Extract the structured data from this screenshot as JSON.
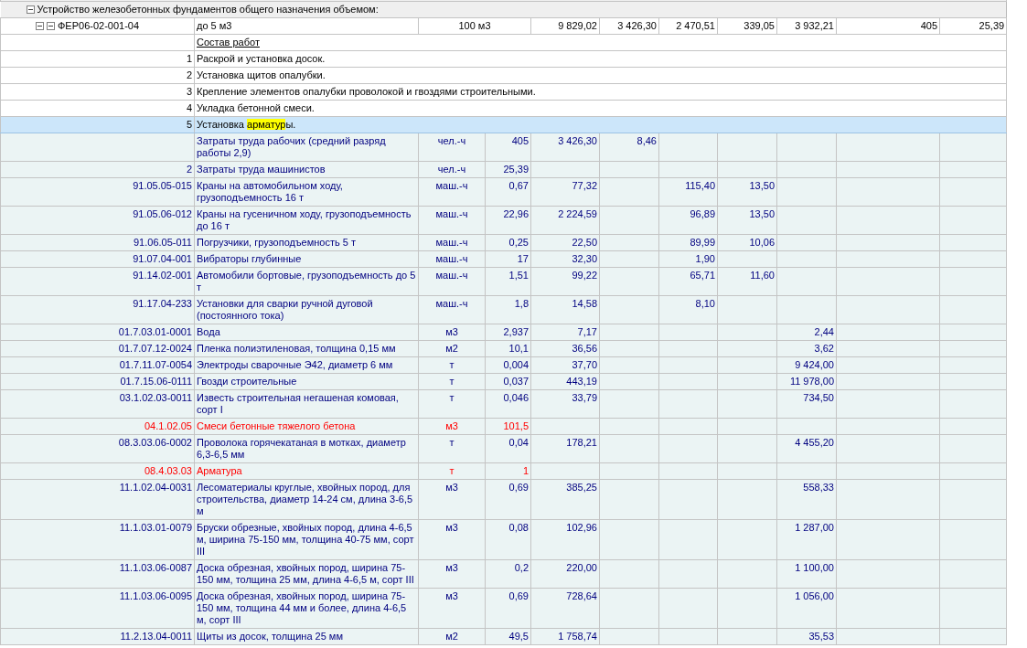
{
  "group": {
    "title": "Устройство железобетонных фундаментов общего назначения объемом:",
    "expanded": true
  },
  "item": {
    "code": "ФЕР06-02-001-04",
    "name": "до 5 м3",
    "unit": "100 м3",
    "expanded": true,
    "values": [
      "9 829,02",
      "3 426,30",
      "2 470,51",
      "339,05",
      "3 932,21",
      "405",
      "25,39"
    ]
  },
  "work_header": "Состав работ",
  "steps": [
    {
      "number": "1",
      "parts": [
        {
          "text": "Раскрой и установка досок.",
          "highlighted": false
        }
      ],
      "selected": false
    },
    {
      "number": "2",
      "parts": [
        {
          "text": "Установка щитов опалубки.",
          "highlighted": false
        }
      ],
      "selected": false
    },
    {
      "number": "3",
      "parts": [
        {
          "text": "Крепление элементов опалубки проволокой и гвоздями строительными.",
          "highlighted": false
        }
      ],
      "selected": false
    },
    {
      "number": "4",
      "parts": [
        {
          "text": "Укладка бетонной смеси.",
          "highlighted": false
        }
      ],
      "selected": false
    },
    {
      "number": "5",
      "parts": [
        {
          "text": "Установка ",
          "highlighted": false
        },
        {
          "text": "арматур",
          "highlighted": true
        },
        {
          "text": "ы.",
          "highlighted": false
        }
      ],
      "selected": true
    }
  ],
  "resources": [
    {
      "name": "Затраты труда рабочих (средний разряд работы 2,9)",
      "unit": "чел.-ч",
      "qty": "405",
      "cols": {
        "col_5": "3 426,30",
        "col_6": "8,46"
      },
      "color": "#000080"
    },
    {
      "code": "2",
      "name": "Затраты труда машинистов",
      "unit": "чел.-ч",
      "qty": "25,39",
      "color": "#000080"
    },
    {
      "code": "91.05.05-015",
      "name": "Краны на автомобильном ходу, грузоподъемность 16 т",
      "unit": "маш.-ч",
      "qty": "0,67",
      "cols": {
        "col_5": "77,32",
        "col_7": "115,40",
        "col_8": "13,50"
      },
      "color": "#000080"
    },
    {
      "code": "91.05.06-012",
      "name": "Краны на гусеничном ходу, грузоподъемность до 16 т",
      "unit": "маш.-ч",
      "qty": "22,96",
      "cols": {
        "col_5": "2 224,59",
        "col_7": "96,89",
        "col_8": "13,50"
      },
      "color": "#000080"
    },
    {
      "code": "91.06.05-011",
      "name": "Погрузчики, грузоподъемность 5 т",
      "unit": "маш.-ч",
      "qty": "0,25",
      "cols": {
        "col_5": "22,50",
        "col_7": "89,99",
        "col_8": "10,06"
      },
      "color": "#000080"
    },
    {
      "code": "91.07.04-001",
      "name": "Вибраторы глубинные",
      "unit": "маш.-ч",
      "qty": "17",
      "cols": {
        "col_5": "32,30",
        "col_7": "1,90"
      },
      "color": "#000080"
    },
    {
      "code": "91.14.02-001",
      "name": "Автомобили бортовые, грузоподъемность до 5 т",
      "unit": "маш.-ч",
      "qty": "1,51",
      "cols": {
        "col_5": "99,22",
        "col_7": "65,71",
        "col_8": "11,60"
      },
      "color": "#000080"
    },
    {
      "code": "91.17.04-233",
      "name": "Установки для сварки ручной дуговой (постоянного тока)",
      "unit": "маш.-ч",
      "qty": "1,8",
      "cols": {
        "col_5": "14,58",
        "col_7": "8,10"
      },
      "color": "#000080"
    },
    {
      "code": "01.7.03.01-0001",
      "name": "Вода",
      "unit": "м3",
      "qty": "2,937",
      "cols": {
        "col_5": "7,17",
        "col_9": "2,44"
      },
      "color": "#000080"
    },
    {
      "code": "01.7.07.12-0024",
      "name": "Пленка полиэтиленовая, толщина 0,15 мм",
      "unit": "м2",
      "qty": "10,1",
      "cols": {
        "col_5": "36,56",
        "col_9": "3,62"
      },
      "color": "#000080"
    },
    {
      "code": "01.7.11.07-0054",
      "name": "Электроды сварочные Э42, диаметр 6 мм",
      "unit": "т",
      "qty": "0,004",
      "cols": {
        "col_5": "37,70",
        "col_9": "9 424,00"
      },
      "color": "#000080"
    },
    {
      "code": "01.7.15.06-0111",
      "name": "Гвозди строительные",
      "unit": "т",
      "qty": "0,037",
      "cols": {
        "col_5": "443,19",
        "col_9": "11 978,00"
      },
      "color": "#000080"
    },
    {
      "code": "03.1.02.03-0011",
      "name": "Известь строительная негашеная комовая, сорт I",
      "unit": "т",
      "qty": "0,046",
      "cols": {
        "col_5": "33,79",
        "col_9": "734,50"
      },
      "color": "#000080"
    },
    {
      "code": "04.1.02.05",
      "name": "Смеси бетонные тяжелого бетона",
      "unit": "м3",
      "qty": "101,5",
      "color": "#ff0000"
    },
    {
      "code": "08.3.03.06-0002",
      "name": "Проволока горячекатаная в мотках, диаметр 6,3-6,5 мм",
      "unit": "т",
      "qty": "0,04",
      "cols": {
        "col_5": "178,21",
        "col_9": "4 455,20"
      },
      "color": "#000080"
    },
    {
      "code": "08.4.03.03",
      "name": "Арматура",
      "unit": "т",
      "qty": "1",
      "color": "#ff0000"
    },
    {
      "code": "11.1.02.04-0031",
      "name": "Лесоматериалы круглые, хвойных пород, для строительства, диаметр 14-24 см, длина 3-6,5 м",
      "unit": "м3",
      "qty": "0,69",
      "cols": {
        "col_5": "385,25",
        "col_9": "558,33"
      },
      "color": "#000080"
    },
    {
      "code": "11.1.03.01-0079",
      "name": "Бруски обрезные, хвойных пород, длина 4-6,5 м, ширина 75-150 мм, толщина 40-75 мм, сорт III",
      "unit": "м3",
      "qty": "0,08",
      "cols": {
        "col_5": "102,96",
        "col_9": "1 287,00"
      },
      "color": "#000080"
    },
    {
      "code": "11.1.03.06-0087",
      "name": "Доска обрезная, хвойных пород, ширина 75-150 мм, толщина 25 мм, длина 4-6,5 м, сорт III",
      "unit": "м3",
      "qty": "0,2",
      "cols": {
        "col_5": "220,00",
        "col_9": "1 100,00"
      },
      "color": "#000080"
    },
    {
      "code": "11.1.03.06-0095",
      "name": "Доска обрезная, хвойных пород, ширина 75-150 мм, толщина 44 мм и более, длина 4-6,5 м, сорт III",
      "unit": "м3",
      "qty": "0,69",
      "cols": {
        "col_5": "728,64",
        "col_9": "1 056,00"
      },
      "color": "#000080"
    },
    {
      "code": "11.2.13.04-0011",
      "name": "Щиты из досок, толщина 25 мм",
      "unit": "м2",
      "qty": "49,5",
      "cols": {
        "col_5": "1 758,74",
        "col_9": "35,53"
      },
      "color": "#000080"
    }
  ]
}
